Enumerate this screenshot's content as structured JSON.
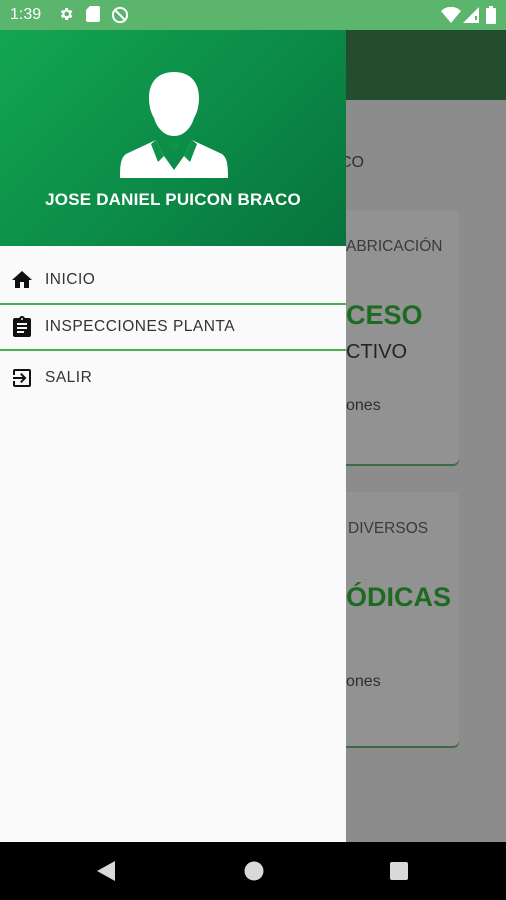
{
  "status_bar": {
    "time": "1:39",
    "left_icons": [
      "settings-icon",
      "sd-card-icon",
      "no-disturb-icon"
    ],
    "right_icons": [
      "wifi-icon",
      "signal-icon",
      "battery-icon"
    ]
  },
  "drawer": {
    "user_name": "JOSE DANIEL PUICON BRACO",
    "menu": [
      {
        "label": "INICIO",
        "icon": "home-icon",
        "active": false
      },
      {
        "label": "INSPECCIONES PLANTA",
        "icon": "clipboard-icon",
        "active": true
      },
      {
        "label": "SALIR",
        "icon": "logout-icon",
        "active": false
      }
    ]
  },
  "background": {
    "greeting_fragment": "CO",
    "card1": {
      "category_fragment": "ABRICACIÓN",
      "title_fragment": "CESO",
      "subtitle_fragment": "CTIVO",
      "info_fragment": "ones"
    },
    "card2": {
      "category_fragment": "DIVERSOS",
      "title_fragment": "ÓDICAS",
      "info_fragment": "ones"
    }
  },
  "nav_bar": {
    "buttons": [
      "back-icon",
      "home-nav-icon",
      "recents-icon"
    ]
  },
  "colors": {
    "status_bar": "#5cb56c",
    "header_gradient_start": "#13a651",
    "header_gradient_end": "#07733c",
    "active_border": "#4caf50",
    "toolbar_dim": "#244d2f"
  }
}
